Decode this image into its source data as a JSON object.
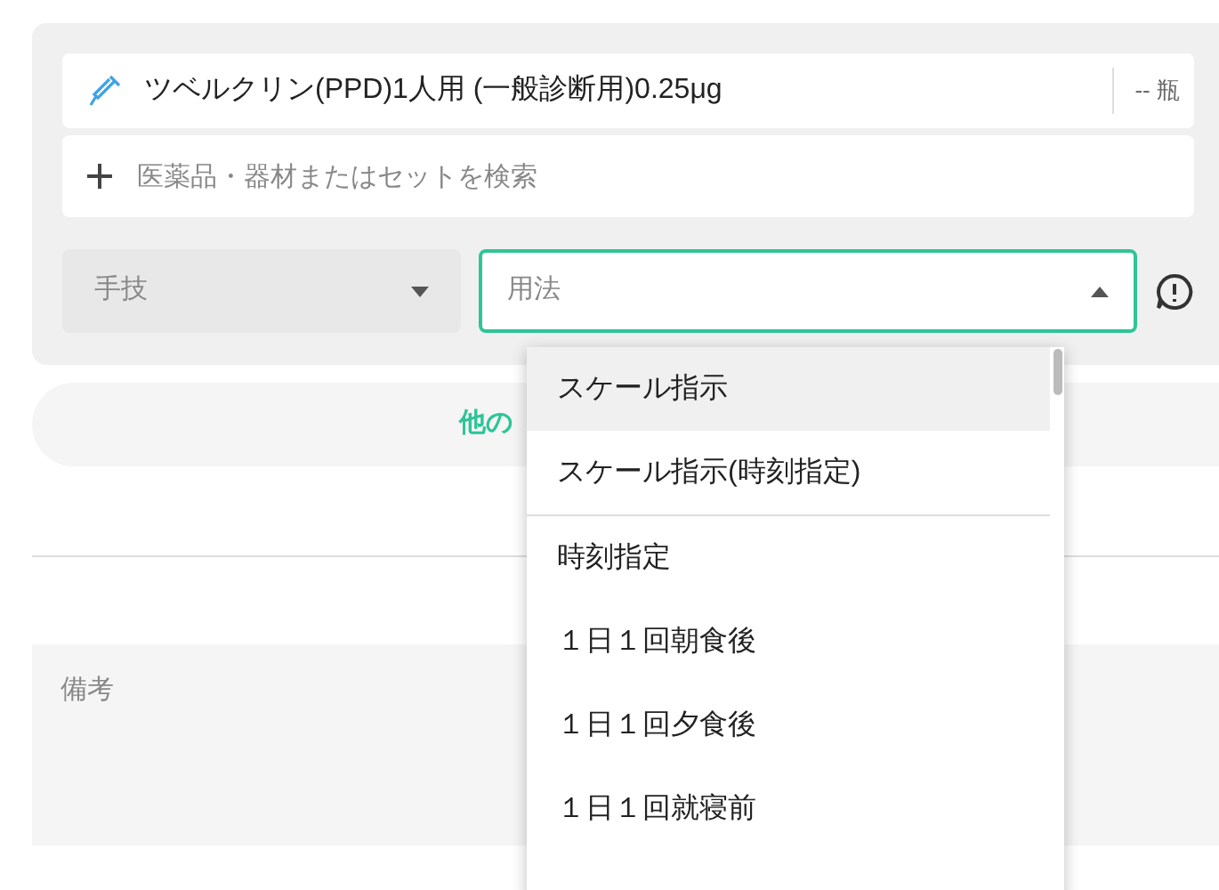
{
  "drug": {
    "name": "ツベルクリン(PPD)1人用 (一般診断用)0.25μg",
    "quantity": "-- 瓶"
  },
  "search": {
    "placeholder": "医薬品・器材またはセットを検索"
  },
  "technique": {
    "placeholder": "手技"
  },
  "usage": {
    "placeholder": "用法",
    "expanded": true
  },
  "other_link": "他の",
  "remarks": {
    "placeholder": "備考"
  },
  "usage_options": [
    {
      "label": "スケール指示",
      "selected": true,
      "separator_after": false
    },
    {
      "label": "スケール指示(時刻指定)",
      "selected": false,
      "separator_after": true
    },
    {
      "label": "時刻指定",
      "selected": false,
      "separator_after": false
    },
    {
      "label": "１日１回朝食後",
      "selected": false,
      "separator_after": false
    },
    {
      "label": "１日１回夕食後",
      "selected": false,
      "separator_after": false
    },
    {
      "label": "１日１回就寝前",
      "selected": false,
      "separator_after": false
    }
  ]
}
